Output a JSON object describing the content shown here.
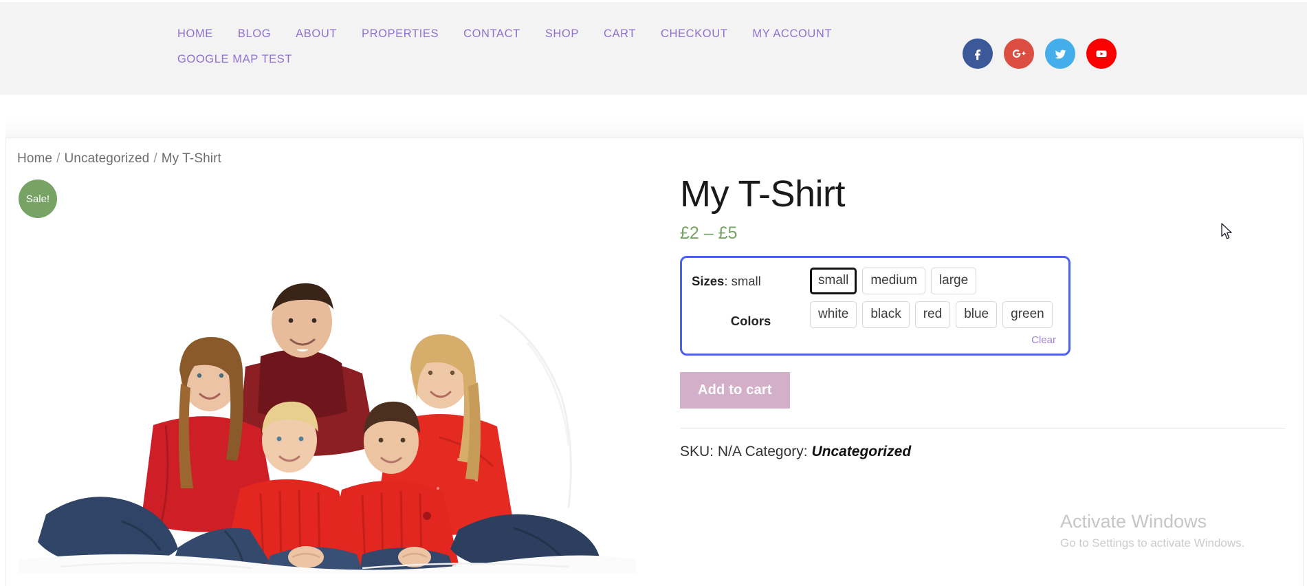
{
  "header": {
    "nav_items": [
      {
        "label": "HOME"
      },
      {
        "label": "BLOG"
      },
      {
        "label": "ABOUT"
      },
      {
        "label": "PROPERTIES"
      },
      {
        "label": "CONTACT"
      },
      {
        "label": "SHOP"
      },
      {
        "label": "CART"
      },
      {
        "label": "CHECKOUT"
      },
      {
        "label": "MY ACCOUNT"
      },
      {
        "label": "GOOGLE MAP TEST"
      }
    ],
    "nav_color": "#8f72cf",
    "background": "#f3f3f3",
    "social": [
      {
        "name": "facebook",
        "color": "#3b5998"
      },
      {
        "name": "google-plus",
        "color": "#dc4e41"
      },
      {
        "name": "twitter",
        "color": "#44aeea"
      },
      {
        "name": "youtube",
        "color": "#fb0000"
      }
    ]
  },
  "breadcrumb": {
    "items": [
      "Home",
      "Uncategorized",
      "My T-Shirt"
    ],
    "separator": "/"
  },
  "product": {
    "badge": "Sale!",
    "badge_color": "#77a464",
    "title": "My T-Shirt",
    "price": "£2 – £5",
    "price_color": "#77a464",
    "image_alt": "Family of five wearing red tops sitting on white blanket",
    "variations": {
      "border_color": "#4a62e8",
      "rows": [
        {
          "label_strong": "Sizes",
          "label_value": ": small",
          "options": [
            {
              "label": "small",
              "selected": true
            },
            {
              "label": "medium",
              "selected": false
            },
            {
              "label": "large",
              "selected": false
            }
          ]
        },
        {
          "label_strong": "Colors",
          "label_value": "",
          "options": [
            {
              "label": "white",
              "selected": false
            },
            {
              "label": "black",
              "selected": false
            },
            {
              "label": "red",
              "selected": false
            },
            {
              "label": "blue",
              "selected": false
            },
            {
              "label": "green",
              "selected": false
            }
          ]
        }
      ],
      "clear_label": "Clear",
      "clear_color": "#9f86d8"
    },
    "add_to_cart_label": "Add to cart",
    "add_to_cart_color": "#d3afca",
    "meta": {
      "sku_label": "SKU:",
      "sku_value": "N/A",
      "category_label": "Category:",
      "category_value": "Uncategorized"
    }
  },
  "watermark": {
    "title": "Activate Windows",
    "subtitle": "Go to Settings to activate Windows."
  }
}
